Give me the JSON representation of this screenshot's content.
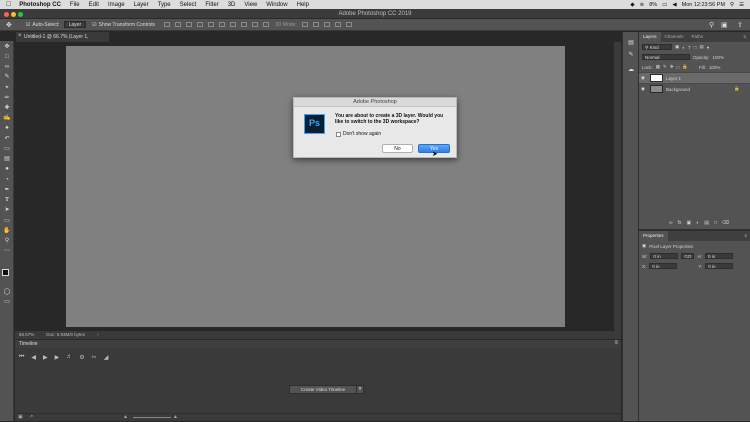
{
  "menubar": {
    "app": "Photoshop CC",
    "items": [
      "File",
      "Edit",
      "Image",
      "Layer",
      "Type",
      "Select",
      "Filter",
      "3D",
      "View",
      "Window",
      "Help"
    ],
    "battery": "8%",
    "clock": "Mon 12:23:56 PM"
  },
  "window": {
    "title": "Adobe Photoshop CC 2019"
  },
  "options": {
    "auto_select_label": "Auto-Select:",
    "auto_select_value": "Layer",
    "transform_label": "Show Transform Controls",
    "mode3d_label": "3D Mode:"
  },
  "document": {
    "tab_label": "Untitled-1 @ 66.7% (Layer 1, RGB/8#) *"
  },
  "status": {
    "zoom": "66.67%",
    "doc": "Doc: 5.93M/0 bytes"
  },
  "timeline": {
    "title": "Timeline",
    "create_button": "Create Video Timeline"
  },
  "layers_panel": {
    "tabs": [
      "Layers",
      "Channels",
      "Paths"
    ],
    "kind": "Kind",
    "blend_mode": "Normal",
    "opacity_label": "Opacity:",
    "opacity": "100%",
    "lock_label": "Lock:",
    "fill_label": "Fill:",
    "fill": "100%",
    "layers": [
      {
        "name": "Layer 1"
      },
      {
        "name": "Background"
      }
    ]
  },
  "properties": {
    "title": "Properties",
    "subtitle": "Pixel Layer Properties",
    "w_label": "W:",
    "w": "0 in",
    "go": "GO",
    "h_label": "H:",
    "h": "0 in",
    "x_label": "X:",
    "x": "0 in",
    "y_label": "Y:",
    "y": "0 in"
  },
  "dialog": {
    "title": "Adobe Photoshop",
    "logo": "Ps",
    "message": "You are about to create a 3D layer.  Would you like to switch to the 3D workspace?",
    "checkbox_label": "Don't show again",
    "no_label": "No",
    "yes_label": "Yes",
    "accent": "#31a8ff"
  }
}
